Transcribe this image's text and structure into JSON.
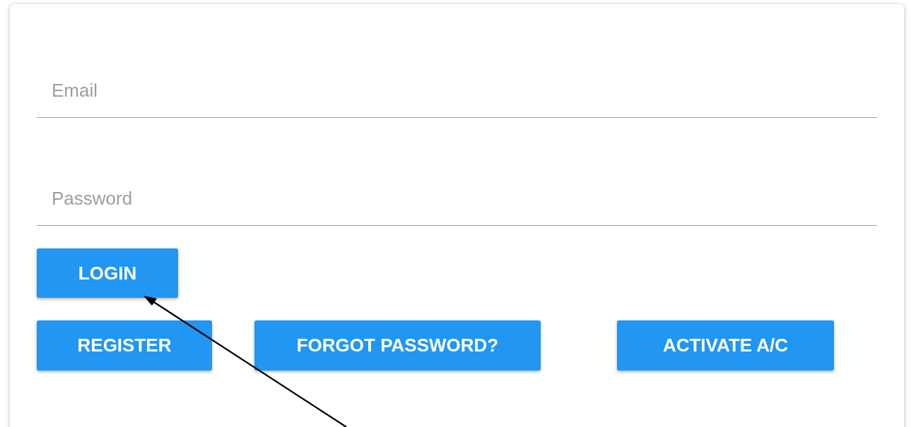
{
  "form": {
    "fields": [
      {
        "placeholder": "Email"
      },
      {
        "placeholder": "Password"
      }
    ],
    "primary_button": "LOGIN",
    "buttons": [
      "REGISTER",
      "FORGOT PASSWORD?",
      "ACTIVATE A/C"
    ]
  }
}
